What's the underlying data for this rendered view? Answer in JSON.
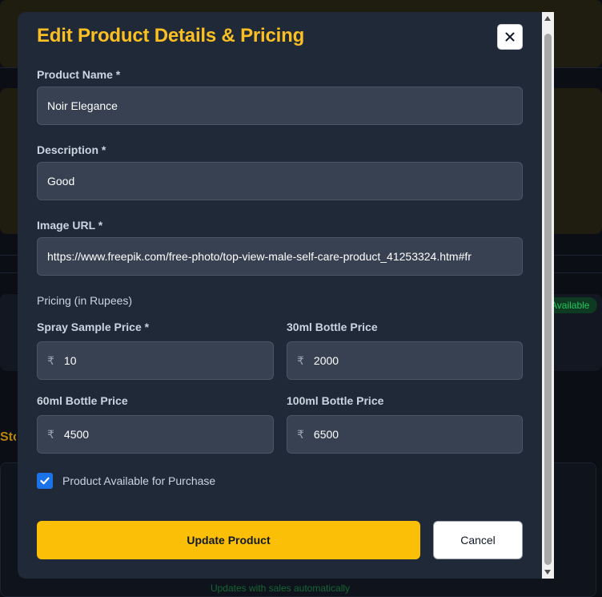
{
  "background": {
    "badge_text": "Available",
    "side_text": "Stock",
    "footer_text": "Updates with sales automatically"
  },
  "modal": {
    "title": "Edit Product Details & Pricing",
    "close_glyph": "×",
    "fields": {
      "product_name": {
        "label": "Product Name *",
        "value": "Noir Elegance"
      },
      "description": {
        "label": "Description *",
        "value": "Good"
      },
      "image_url": {
        "label": "Image URL *",
        "value": "https://www.freepik.com/free-photo/top-view-male-self-care-product_41253324.htm#fr"
      }
    },
    "pricing": {
      "section_label": "Pricing (in Rupees)",
      "currency_symbol": "₹",
      "spray_sample": {
        "label": "Spray Sample Price *",
        "value": "10"
      },
      "bottle_30ml": {
        "label": "30ml Bottle Price",
        "value": "2000"
      },
      "bottle_60ml": {
        "label": "60ml Bottle Price",
        "value": "4500"
      },
      "bottle_100ml": {
        "label": "100ml Bottle Price",
        "value": "6500"
      }
    },
    "availability": {
      "label": "Product Available for Purchase",
      "checked": true
    },
    "buttons": {
      "update": "Update Product",
      "cancel": "Cancel"
    }
  },
  "colors": {
    "accent": "#fbbf24",
    "modal_bg": "#1f2937",
    "input_bg": "#374151",
    "checkbox": "#1a73e8"
  }
}
